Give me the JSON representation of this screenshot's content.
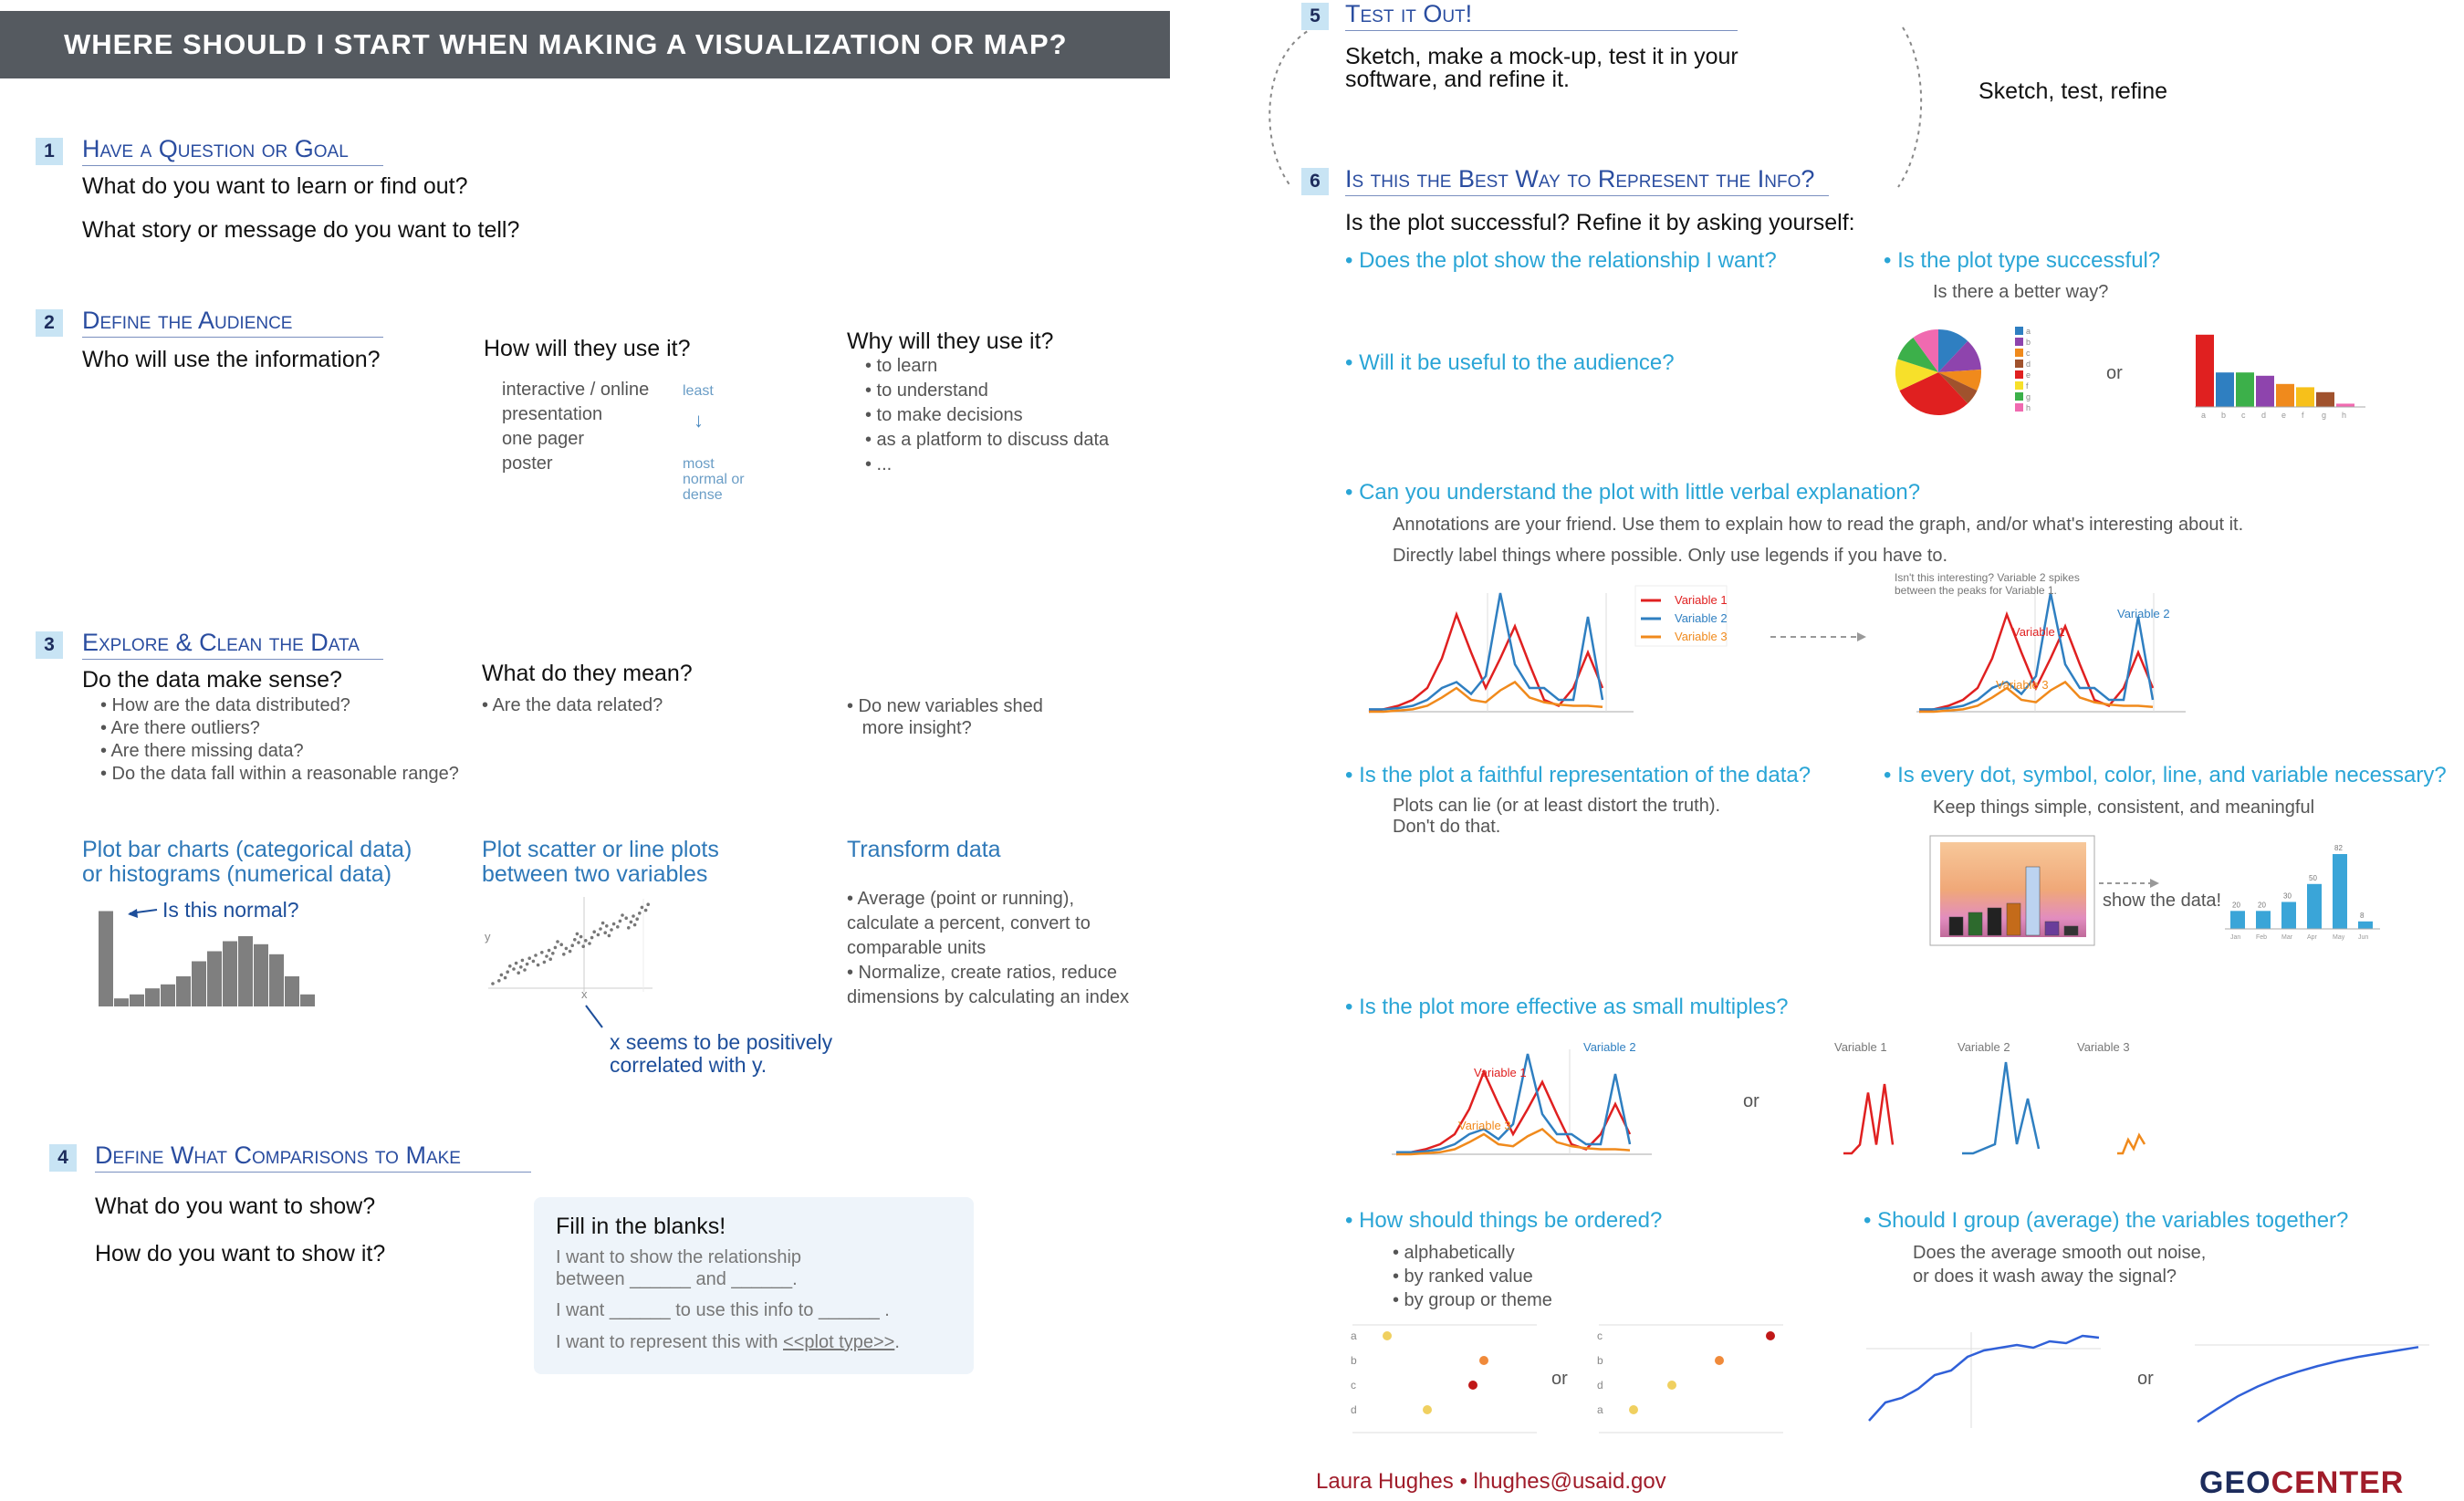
{
  "title": "Where should I start when making a visualization or map?",
  "steps": {
    "s1": {
      "num": "1",
      "title": "Have a Question or Goal",
      "q1": "What do you want to learn or find out?",
      "q2": "What story or message do you want to tell?"
    },
    "s2": {
      "num": "2",
      "title": "Define the Audience",
      "q1": "Who will use the information?",
      "how_title": "How will they use it?",
      "how_items": [
        "interactive / online",
        "presentation",
        "one pager",
        "poster"
      ],
      "scale_top": "least",
      "scale_bottom": "most\nnormal or\ndense",
      "why_title": "Why will they use it?",
      "why_items": [
        "• to learn",
        "• to understand",
        "• to make decisions",
        "• as a platform to discuss data",
        "• ..."
      ]
    },
    "s3": {
      "num": "3",
      "title": "Explore & Clean the Data",
      "q1": "Do the data make sense?",
      "items": [
        "• How are the data distributed?",
        "• Are there outliers?",
        "• Are there missing data?",
        "• Do the data fall within a reasonable range?"
      ],
      "mean_title": "What do they mean?",
      "mean_item": "• Are the data related?",
      "new_vars": "• Do new variables shed\n   more insight?",
      "bar_title": "Plot bar charts (categorical data)\nor histograms (numerical data)",
      "bar_note": "Is this normal?",
      "scatter_title": "Plot scatter or line plots\nbetween two variables",
      "scatter_note": "x seems to be positively\ncorrelated with y.",
      "axis_x": "x",
      "axis_y": "y",
      "transform_title": "Transform data",
      "transform_items": "• Average (point or running),\ncalculate a percent, convert to\ncomparable units\n• Normalize, create ratios, reduce\ndimensions by calculating an index"
    },
    "s4": {
      "num": "4",
      "title": "Define What Comparisons to Make",
      "q1": "What do you want to show?",
      "q2": "How do you want to show it?",
      "fill_title": "Fill in the blanks!",
      "fill1": "I want to show the relationship\nbetween ______ and ______.",
      "fill2": "I want ______ to use this info to ______ .",
      "fill3a": "I want to represent this with ",
      "fill3b": "<<plot type>>",
      "fill3c": "."
    },
    "s5": {
      "num": "5",
      "title": "Test it Out!",
      "text": "Sketch, make a mock-up, test it in your\nsoftware, and refine it.",
      "cycle": "Sketch, test, refine"
    },
    "s6": {
      "num": "6",
      "title": "Is this the Best Way to Represent the Info?",
      "intro": "Is the plot successful?  Refine it by asking yourself:",
      "q_rel": "• Does the plot show the relationship I want?",
      "q_type": "• Is the plot type successful?",
      "q_type_sub": "Is there a better way?",
      "q_useful": "• Will it be useful to the audience?",
      "or": "or",
      "q_understand": "• Can you understand the plot with little verbal explanation?",
      "understand_1": "Annotations are your friend. Use them to explain how to read the graph, and/or what's interesting about it.",
      "understand_2": "Directly label things where possible.  Only use legends if you have to.",
      "legend": [
        "Variable 1",
        "Variable 2",
        "Variable 3"
      ],
      "annot": "Isn't this interesting? Variable 2 spikes\nbetween the peaks for Variable 1.",
      "q_faithful": "• Is the plot a faithful representation of the data?",
      "faithful_sub": "Plots can lie (or at least distort the truth).\nDon't do that.",
      "q_necessary": "• Is every dot, symbol, color, line, and variable necessary?",
      "necessary_sub": "Keep things simple, consistent, and meaningful",
      "show_data": "show the data!",
      "q_multiples": "• Is the plot more effective as small multiples?",
      "q_order": "• How should things be ordered?",
      "order_items": [
        "• alphabetically",
        "• by ranked value",
        "• by group or theme"
      ],
      "q_group": "• Should I group (average) the variables together?",
      "group_sub": "Does the average smooth out noise,\nor does it wash away the signal?",
      "pie_legend": [
        "a",
        "b",
        "c",
        "d",
        "e",
        "f",
        "g",
        "h"
      ],
      "bar_labels": [
        "a",
        "b",
        "c",
        "d",
        "e",
        "f",
        "g",
        "h"
      ],
      "dot_labels_alpha": [
        "a",
        "b",
        "c",
        "d"
      ],
      "dot_labels_rank": [
        "c",
        "b",
        "d",
        "a"
      ],
      "mini_labels": [
        "Jan",
        "Feb",
        "Mar",
        "Apr",
        "May",
        "Jun"
      ],
      "mini_values": [
        "20",
        "20",
        "30",
        "50",
        "82",
        "8"
      ]
    }
  },
  "footer": {
    "author": "Laura Hughes • lhughes@usaid.gov",
    "logo_a": "GEO",
    "logo_b": "CENTER"
  },
  "colors": {
    "header": "#555a60",
    "heading": "#2a4da0",
    "accent": "#2aa5d6",
    "var1": "#e02020",
    "var2": "#2f7fc1",
    "var3": "#f08a1c"
  }
}
